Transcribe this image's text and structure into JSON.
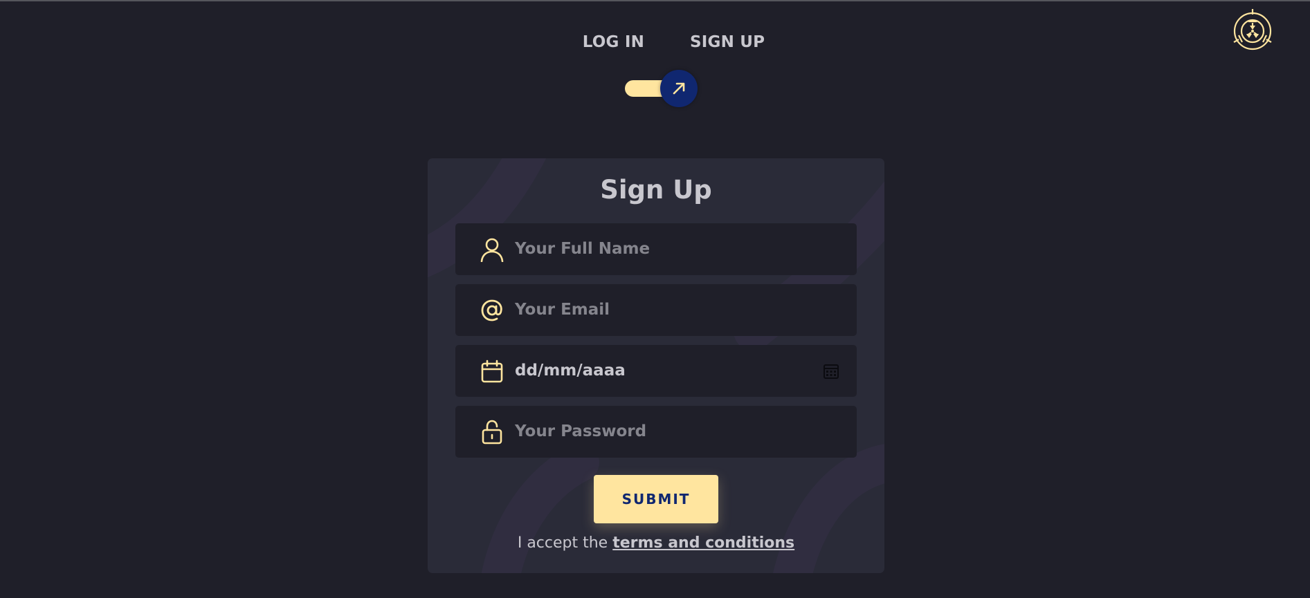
{
  "nav": {
    "login_label": "LOG IN",
    "signup_label": "SIGN UP"
  },
  "toggle": {
    "state": "sign-up",
    "icon": "arrow-up-right-icon"
  },
  "logo": {
    "icon": "scp-logo"
  },
  "form": {
    "title": "Sign Up",
    "fields": [
      {
        "icon": "user-icon",
        "placeholder": "Your Full Name",
        "value": ""
      },
      {
        "icon": "at-sign-icon",
        "placeholder": "Your Email",
        "value": ""
      },
      {
        "icon": "calendar-icon",
        "placeholder": "dd/mm/aaaa",
        "value": ""
      },
      {
        "icon": "lock-icon",
        "placeholder": "Your Password",
        "value": ""
      }
    ],
    "submit_label": "SUBMIT",
    "terms_prefix": "I accept the",
    "terms_link": "terms and conditions"
  },
  "colors": {
    "background": "#1f1f29",
    "card": "#2a2b38",
    "accent": "#ffe59f",
    "knob": "#102770",
    "text": "#c8c7ce",
    "placeholder": "#85858d"
  }
}
